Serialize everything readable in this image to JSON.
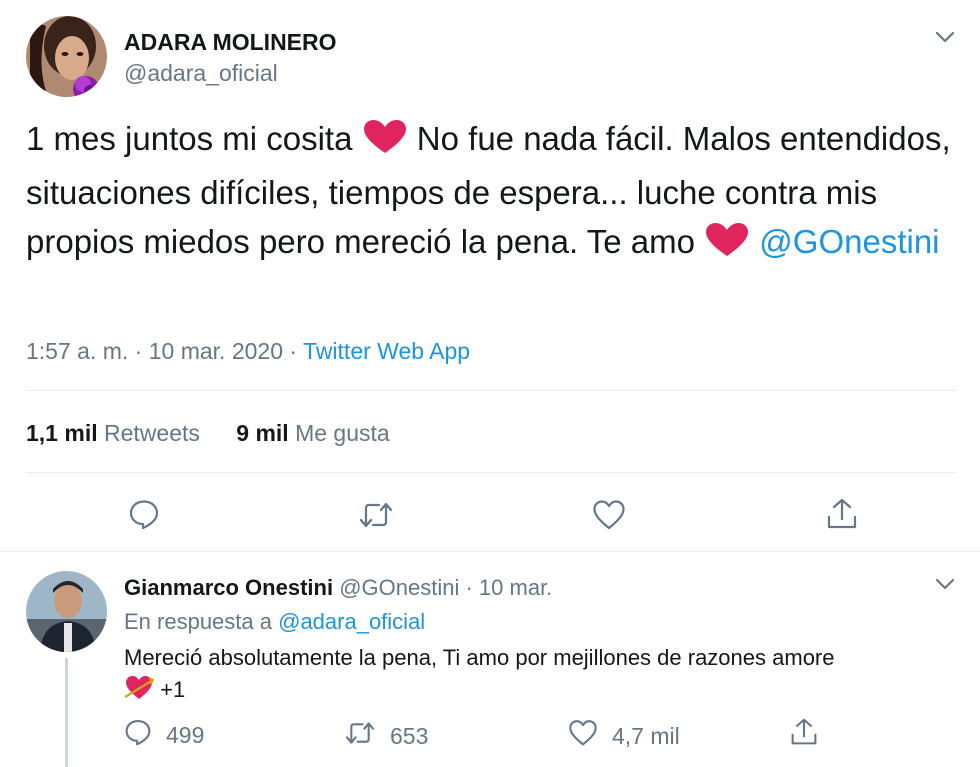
{
  "tweet": {
    "author_name": "ADARA MOLINERO",
    "author_handle": "@adara_oficial",
    "text_part1": "1 mes juntos mi cosita ",
    "text_part2": " No fue nada fácil. Malos entendidos, situaciones difíciles, tiempos de espera... luche contra mis propios miedos pero mereció la pena. Te amo ",
    "text_mention": "@GOnestini",
    "time": "1:57 a. m.",
    "separator": "·",
    "date": "10 mar. 2020",
    "source": "Twitter Web App",
    "retweets_count": "1,1 mil",
    "retweets_label": "Retweets",
    "likes_count": "9 mil",
    "likes_label": "Me gusta"
  },
  "reply": {
    "author_name": "Gianmarco Onestini",
    "author_handle": "@GOnestini",
    "separator": "·",
    "date": "10 mar.",
    "in_reply_label": "En respuesta a",
    "in_reply_mention": "@adara_oficial",
    "text": "Mereció absolutamente la pena, Ti amo por mejillones de razones amore",
    "text_suffix": "+1",
    "replies_count": "499",
    "retweets_count": "653",
    "likes_count": "4,7 mil"
  },
  "colors": {
    "link": "#1b95e0",
    "secondary_text": "#657786",
    "icon": "#657786",
    "heart_emoji": "#e0245e",
    "divider": "#e6ecf0"
  },
  "icons": [
    "chevron-down-icon",
    "reply-icon",
    "retweet-icon",
    "like-icon",
    "share-icon",
    "red-heart-emoji",
    "heart-with-arrow-emoji"
  ]
}
